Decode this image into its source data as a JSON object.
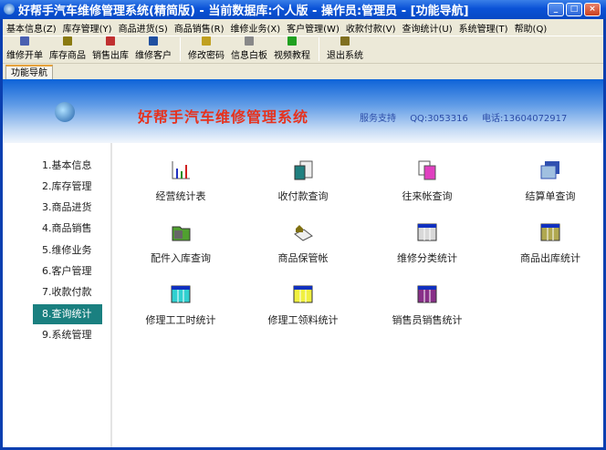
{
  "window": {
    "title": "好帮手汽车维修管理系统(精简版) - 当前数据库:个人版 - 操作员:管理员 - [功能导航]",
    "min": "_",
    "max": "□",
    "close": "×"
  },
  "menu": [
    "基本信息(Z)",
    "库存管理(Y)",
    "商品进货(S)",
    "商品销售(R)",
    "维修业务(X)",
    "客户管理(W)",
    "收款付款(V)",
    "查询统计(U)",
    "系统管理(T)",
    "帮助(Q)"
  ],
  "toolbar": {
    "group1": [
      {
        "label": "维修开单",
        "icon": "repair-order-icon"
      },
      {
        "label": "库存商品",
        "icon": "warehouse-icon"
      },
      {
        "label": "销售出库",
        "icon": "sales-out-icon"
      },
      {
        "label": "维修客户",
        "icon": "customer-icon"
      }
    ],
    "group2": [
      {
        "label": "修改密码",
        "icon": "key-icon"
      },
      {
        "label": "信息白板",
        "icon": "whiteboard-icon"
      },
      {
        "label": "视频教程",
        "icon": "help-video-icon"
      }
    ],
    "group3": [
      {
        "label": "退出系统",
        "icon": "exit-door-icon"
      }
    ]
  },
  "tab": "功能导航",
  "banner": {
    "brand": "好帮手汽车维修管理系统",
    "support": "服务支持",
    "qq": "QQ:3053316",
    "phone": "电话:13604072917"
  },
  "sidebar": [
    "1.基本信息",
    "2.库存管理",
    "3.商品进货",
    "4.商品销售",
    "5.维修业务",
    "6.客户管理",
    "7.收款付款",
    "8.查询统计",
    "9.系统管理"
  ],
  "selected_index": 7,
  "functions": [
    {
      "label": "经营统计表",
      "icon": "chart-icon"
    },
    {
      "label": "收付款查询",
      "icon": "calculator-icon"
    },
    {
      "label": "往来帐查询",
      "icon": "documents-icon"
    },
    {
      "label": "结算单查询",
      "icon": "stacked-forms-icon"
    },
    {
      "label": "配件入库查询",
      "icon": "parts-folder-icon"
    },
    {
      "label": "商品保管帐",
      "icon": "house-ledger-icon"
    },
    {
      "label": "维修分类统计",
      "icon": "gray-table-icon",
      "color": "#d8d8d8"
    },
    {
      "label": "商品出库统计",
      "icon": "olive-table-icon",
      "color": "#b0a850"
    },
    {
      "label": "修理工工时统计",
      "icon": "cyan-table-icon",
      "color": "#30d0d0"
    },
    {
      "label": "修理工领料统计",
      "icon": "yellow-table-icon",
      "color": "#f0f040"
    },
    {
      "label": "销售员销售统计",
      "icon": "purple-table-icon",
      "color": "#883088"
    }
  ]
}
